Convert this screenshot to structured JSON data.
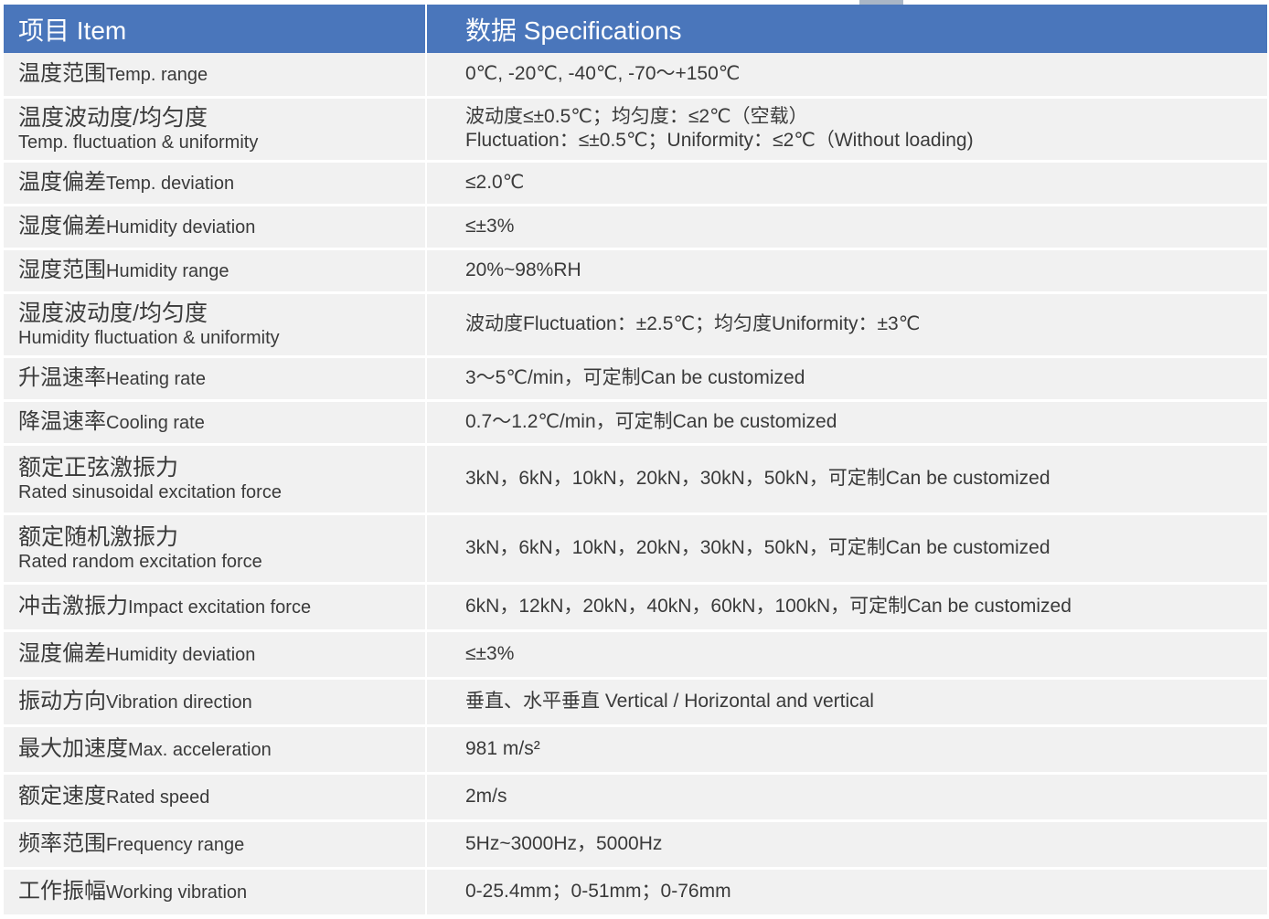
{
  "header": {
    "col1": "项目 Item",
    "col2": "数据 Specifications"
  },
  "rows": [
    {
      "item_cn": "温度范围",
      "item_en": "Temp. range",
      "value": "0℃, -20℃, -40℃, -70～+150℃"
    },
    {
      "item_cn": "温度波动度/均匀度",
      "item_en": "Temp. fluctuation & uniformity",
      "value": "波动度≤±0.5℃；均匀度：≤2℃（空载）",
      "value2": "Fluctuation：≤±0.5℃；Uniformity：≤2℃（Without loading)"
    },
    {
      "item_cn": "温度偏差",
      "item_en": "Temp. deviation",
      "value": "≤2.0℃"
    },
    {
      "item_cn": "湿度偏差",
      "item_en": "Humidity deviation",
      "value": "≤±3%"
    },
    {
      "item_cn": "湿度范围",
      "item_en": "Humidity range",
      "value": "20%~98%RH"
    },
    {
      "item_cn": "湿度波动度/均匀度",
      "item_en": "Humidity fluctuation & uniformity",
      "value": "波动度Fluctuation：±2.5℃；均匀度Uniformity：±3℃"
    },
    {
      "item_cn": "升温速率",
      "item_en": "Heating rate",
      "value": "3～5℃/min，可定制Can be customized"
    },
    {
      "item_cn": "降温速率",
      "item_en": "Cooling rate",
      "value": "0.7～1.2℃/min，可定制Can be customized"
    },
    {
      "item_cn": "额定正弦激振力",
      "item_en": "Rated sinusoidal excitation force",
      "value": "3kN，6kN，10kN，20kN，30kN，50kN，可定制Can be customized"
    },
    {
      "item_cn": "额定随机激振力",
      "item_en": "Rated random excitation force",
      "value": "3kN，6kN，10kN，20kN，30kN，50kN，可定制Can be customized"
    },
    {
      "item_cn": "冲击激振力",
      "item_en": "Impact excitation force",
      "value": "6kN，12kN，20kN，40kN，60kN，100kN，可定制Can be customized"
    },
    {
      "item_cn": "湿度偏差",
      "item_en": "Humidity deviation",
      "value": "≤±3%"
    },
    {
      "item_cn": "振动方向",
      "item_en": "Vibration direction",
      "value": "垂直、水平垂直 Vertical / Horizontal and vertical"
    },
    {
      "item_cn": "最大加速度",
      "item_en": "Max. acceleration",
      "value": "981 m/s²"
    },
    {
      "item_cn": "额定速度",
      "item_en": "Rated speed",
      "value": "2m/s"
    },
    {
      "item_cn": "频率范围",
      "item_en": "Frequency range",
      "value": "5Hz~3000Hz，5000Hz"
    },
    {
      "item_cn": "工作振幅",
      "item_en": "Working vibration",
      "value": "0-25.4mm；0-51mm；0-76mm"
    }
  ]
}
